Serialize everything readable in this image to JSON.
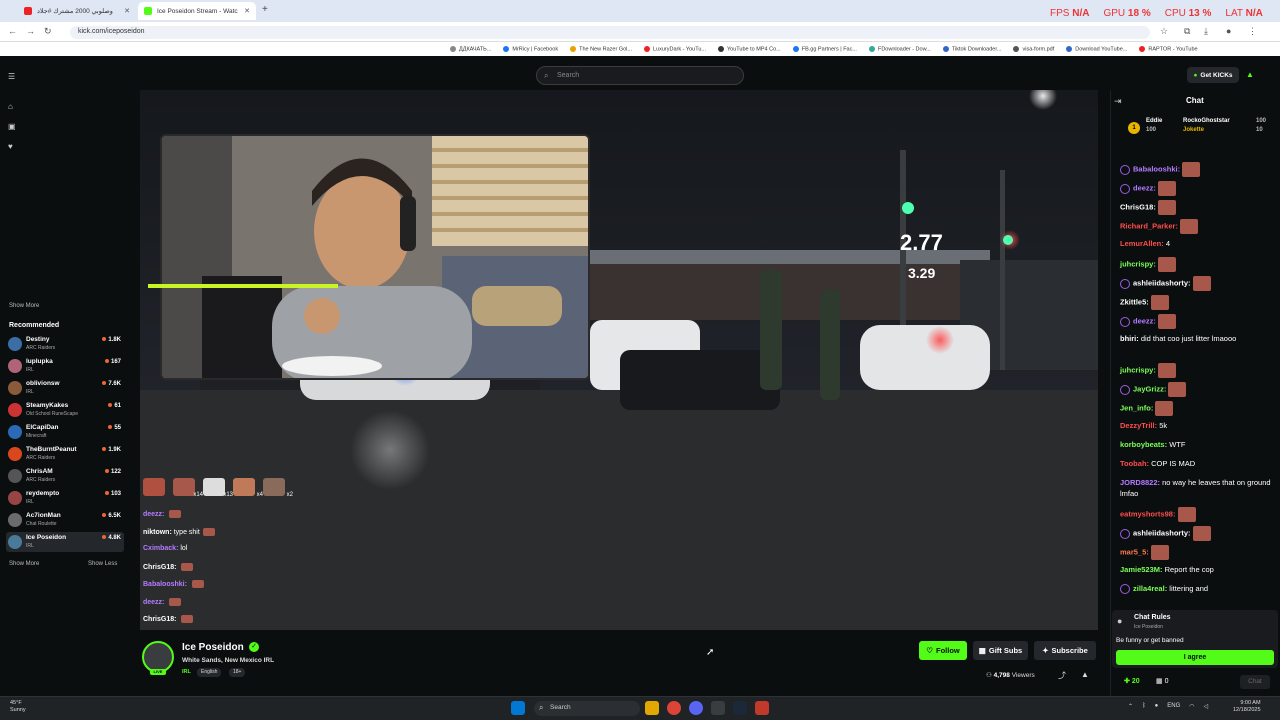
{
  "browser": {
    "tabs": [
      {
        "title": "وصلوبي 2000 مشترك #جلاد",
        "color": "#e22"
      },
      {
        "title": "Ice Poseidon Stream - Watc",
        "color": "#53fc18"
      }
    ],
    "url": "kick.com/iceposeidon",
    "bookmarks": [
      {
        "label": "ДДКАЧАТЬ...",
        "color": "#888"
      },
      {
        "label": "MrRicy | Facebook",
        "color": "#1877f2"
      },
      {
        "label": "The New Razer Gol...",
        "color": "#e8a200"
      },
      {
        "label": "LuxuryDark - YouTu...",
        "color": "#e22"
      },
      {
        "label": "YouTube to MP4 Co...",
        "color": "#333"
      },
      {
        "label": "FB.gg Partners | Fac...",
        "color": "#1877f2"
      },
      {
        "label": "FDownloader - Dow...",
        "color": "#3a9"
      },
      {
        "label": "Tiktok Downloader...",
        "color": "#36c"
      },
      {
        "label": "visa-form.pdf",
        "color": "#555"
      },
      {
        "label": "Download YouTube...",
        "color": "#36c"
      },
      {
        "label": "RAPTOR - YouTube",
        "color": "#e22"
      }
    ]
  },
  "overlay": {
    "fps_label": "FPS",
    "fps": "N/A",
    "gpu_label": "GPU",
    "gpu": "18 %",
    "cpu_label": "CPU",
    "cpu": "13 %",
    "lat_label": "LAT",
    "lat": "N/A"
  },
  "topnav": {
    "search_placeholder": "Search",
    "kicks_label": "Get KICKs"
  },
  "sidebar": {
    "show_more": "Show More",
    "recommended_title": "Recommended",
    "recommended": [
      {
        "name": "Destiny",
        "category": "ARC Raiders",
        "viewers": "1.8K",
        "color": "#3a6ea5"
      },
      {
        "name": "luplupka",
        "category": "IRL",
        "viewers": "167",
        "color": "#b0647a"
      },
      {
        "name": "oblivionsw",
        "category": "IRL",
        "viewers": "7.6K",
        "color": "#8a5a3a"
      },
      {
        "name": "SteamyKakes",
        "category": "Old School RuneScape",
        "viewers": "61",
        "color": "#c33"
      },
      {
        "name": "ElCapiDan",
        "category": "Minecraft",
        "viewers": "55",
        "color": "#2a6ab7"
      },
      {
        "name": "TheBurntPeanut",
        "category": "ARC Raiders",
        "viewers": "1.9K",
        "color": "#d9481c"
      },
      {
        "name": "ChrisAM",
        "category": "ARC Raiders",
        "viewers": "122",
        "color": "#555"
      },
      {
        "name": "reydempto",
        "category": "IRL",
        "viewers": "103",
        "color": "#944"
      },
      {
        "name": "Ac7ionMan",
        "category": "Chat Roulette",
        "viewers": "6.5K",
        "color": "#6b6b6b"
      },
      {
        "name": "Ice Poseidon",
        "category": "IRL",
        "viewers": "4.8K",
        "color": "#4a7a9a"
      }
    ],
    "show_more_2": "Show More",
    "show_less": "Show Less"
  },
  "video_chat_overlay": {
    "emote_counts": [
      "x14",
      "x13",
      "x4",
      "x2"
    ],
    "lines": [
      {
        "user": "deezz:",
        "text": "",
        "emote": true,
        "color": "#b57cff"
      },
      {
        "user": "niktown:",
        "text": "type shit",
        "emote": true,
        "color": "#fff"
      },
      {
        "user": "Cximback:",
        "text": "lol",
        "emote": false,
        "color": "#b57cff"
      },
      {
        "user": "ChrisG18:",
        "text": "",
        "emote": true,
        "color": "#fff"
      },
      {
        "user": "Babalooshki:",
        "text": "",
        "emote": true,
        "color": "#b57cff"
      },
      {
        "user": "deezz:",
        "text": "",
        "emote": true,
        "color": "#b57cff"
      },
      {
        "user": "ChrisG18:",
        "text": "",
        "emote": true,
        "color": "#fff"
      }
    ]
  },
  "stream": {
    "name": "Ice Poseidon",
    "title": "White Sands, New Mexico IRL",
    "category": "IRL",
    "tags": [
      "English",
      "18+"
    ],
    "live_label": "LIVE",
    "follow": "Follow",
    "gift_subs": "Gift Subs",
    "subscribe": "Subscribe",
    "viewers_count": "4,798",
    "viewers_label": "Viewers"
  },
  "chat": {
    "title": "Chat",
    "pinned": [
      {
        "name": "Eddie",
        "amount": "100"
      },
      {
        "name": "RockoGhoststar",
        "amount": "100"
      },
      {
        "name": "Jokette",
        "amount": "10"
      }
    ],
    "messages": [
      {
        "user": "Babalooshki:",
        "text": "",
        "emote": true,
        "color": "#b57cff",
        "badge": true
      },
      {
        "user": "deezz:",
        "text": "",
        "emote": true,
        "color": "#b57cff",
        "badge": true
      },
      {
        "user": "ChrisG18:",
        "text": "",
        "emote": true,
        "color": "#fff",
        "badge": false
      },
      {
        "user": "Richard_Parker:",
        "text": "",
        "emote": true,
        "color": "#ff4d4d",
        "badge": false
      },
      {
        "user": "LemurAllen:",
        "text": "4",
        "emote": false,
        "color": "#ff4d4d",
        "badge": false
      },
      {
        "user": "juhcrispy:",
        "text": "",
        "emote": true,
        "color": "#7cff5a",
        "badge": false
      },
      {
        "user": "ashleiidashorty:",
        "text": "",
        "emote": true,
        "color": "#fff",
        "badge": true
      },
      {
        "user": "Zkittle5:",
        "text": "",
        "emote": true,
        "color": "#fff",
        "badge": false
      },
      {
        "user": "deezz:",
        "text": "",
        "emote": true,
        "color": "#b57cff",
        "badge": true
      },
      {
        "user": "bhiri:",
        "text": "did that coo just litter lmaooo",
        "emote": false,
        "color": "#fff",
        "badge": false
      },
      {
        "user": "juhcrispy:",
        "text": "",
        "emote": true,
        "color": "#7cff5a",
        "badge": false
      },
      {
        "user": "JayGrizz:",
        "text": "",
        "emote": true,
        "color": "#7cff5a",
        "badge": true
      },
      {
        "user": "Jen_info:",
        "text": "",
        "emote": true,
        "color": "#7cff5a",
        "badge": false
      },
      {
        "user": "DezzyTrill:",
        "text": "5k",
        "emote": false,
        "color": "#ff4d4d",
        "badge": false
      },
      {
        "user": "korboybeats:",
        "text": "WTF",
        "emote": false,
        "color": "#7cff5a",
        "badge": false
      },
      {
        "user": "Toobah:",
        "text": "COP IS MAD",
        "emote": false,
        "color": "#ff4d4d",
        "badge": false
      },
      {
        "user": "JORD8822:",
        "text": "no way he leaves that on ground lmfao",
        "emote": false,
        "color": "#b57cff",
        "badge": false
      },
      {
        "user": "eatmyshorts98:",
        "text": "",
        "emote": true,
        "color": "#ff4d4d",
        "badge": false
      },
      {
        "user": "ashleiidashorty:",
        "text": "",
        "emote": true,
        "color": "#fff",
        "badge": true
      },
      {
        "user": "mar5_5:",
        "text": "",
        "emote": true,
        "color": "#ff7a4d",
        "badge": false
      },
      {
        "user": "Jamie523M:",
        "text": "Report the cop",
        "emote": false,
        "color": "#7cff5a",
        "badge": false
      },
      {
        "user": "zilla4real:",
        "text": "littering and",
        "emote": false,
        "color": "#7cff5a",
        "badge": true
      }
    ],
    "rules_title": "Chat Rules",
    "rules_sub": "Ice Poseidon",
    "rules_text": "Be funny or get banned",
    "agree": "I agree",
    "kicks_count": "20",
    "gift_count": "0",
    "chat_button": "Chat"
  },
  "taskbar": {
    "weather_temp": "45°F",
    "weather_desc": "Sunny",
    "search": "Search",
    "lang": "ENG",
    "time": "9:00 AM",
    "date": "12/18/2025"
  }
}
